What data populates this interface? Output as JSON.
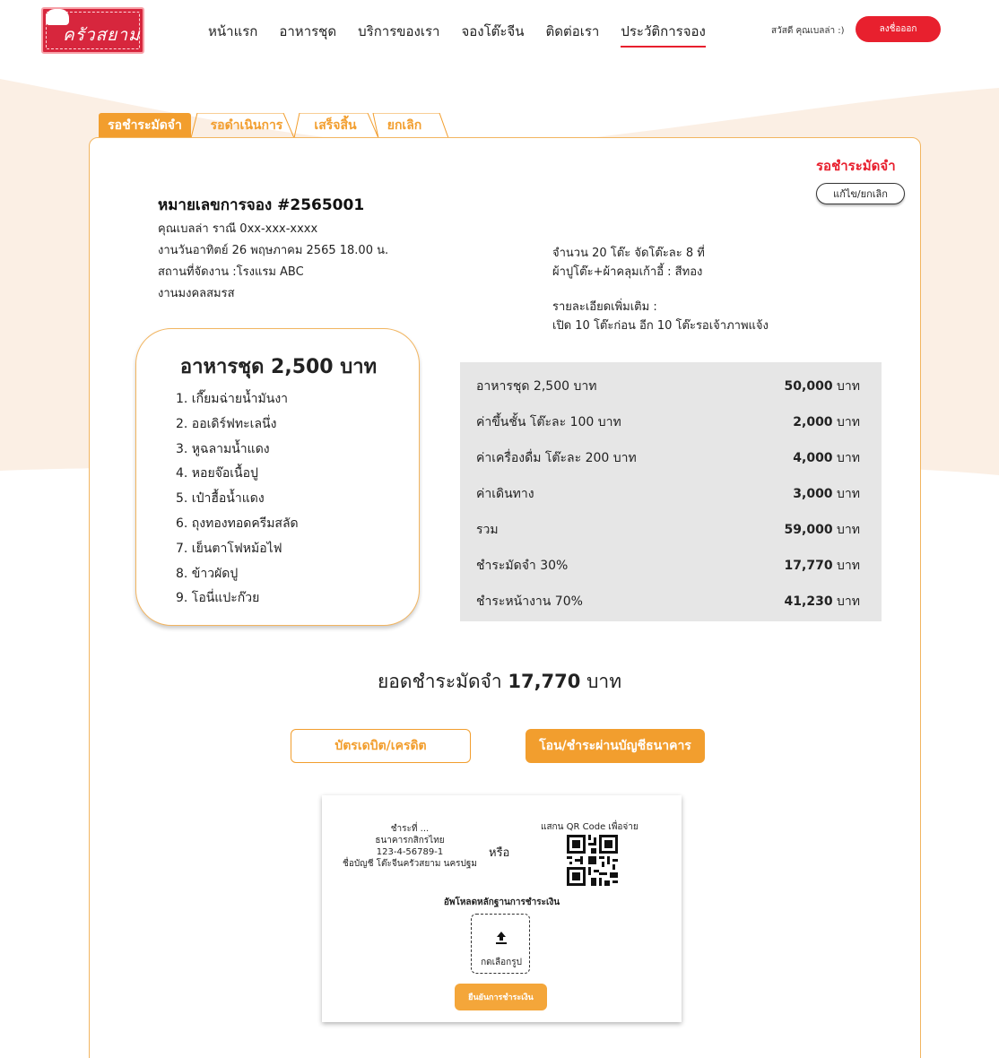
{
  "logo": {
    "text": "ครัวสยาม"
  },
  "nav": {
    "items": [
      {
        "label": "หน้าแรก"
      },
      {
        "label": "อาหารชุด"
      },
      {
        "label": "บริการของเรา"
      },
      {
        "label": "จองโต๊ะจีน"
      },
      {
        "label": "ติดต่อเรา"
      },
      {
        "label": "ประวัติการจอง"
      }
    ],
    "active": "ประวัติการจอง"
  },
  "user": {
    "greeting": "สวัสดี คุณเบลล่า :)",
    "logout_label": "ลงชื่อออก"
  },
  "tabs": [
    {
      "label": "รอชำระมัดจำ"
    },
    {
      "label": "รอดำเนินการ"
    },
    {
      "label": "เสร็จสิ้น"
    },
    {
      "label": "ยกเลิก"
    }
  ],
  "booking": {
    "status": "รอชำระมัดจำ",
    "edit_label": "แก้ไข/ยกเลิก",
    "number": "หมายเลขการจอง #2565001",
    "customer": "คุณเบลล่า ราณี 0xx-xxx-xxxx",
    "date": "งานวันอาทิตย์ 26 พฤษภาคม 2565 18.00 น.",
    "venue": "สถานที่จัดงาน :โรงแรม ABC",
    "event": "งานมงคลสมรส",
    "tables": "จำนวน 20 โต๊ะ จัดโต๊ะละ 8 ที่",
    "cloth": "ผ้าปูโต๊ะ+ผ้าคลุมเก้าอี้ : สีทอง",
    "details_label": "รายละเอียดเพิ่มเติม :",
    "details": "เปิด 10 โต๊ะก่อน อีก 10 โต๊ะรอเจ้าภาพแจ้ง"
  },
  "menu": {
    "title": "อาหารชุด 2,500 บาท",
    "items": [
      "1. เกี๊ยมฉ่ายน้ำมันงา",
      "2. ออเดิร์ฟทะเลนึ่ง",
      "3. หูฉลามน้ำแดง",
      "4. หอยจ๊อเนื้อปู",
      "5. เป๋าฮื้อน้ำแดง",
      "6. ถุงทองทอดครีมสลัด",
      "7. เย็นตาโฟหม้อไฟ",
      "8. ข้าวผัดปู",
      "9. โอนี่แปะก๊วย"
    ]
  },
  "prices": [
    {
      "label": "อาหารชุด 2,500 บาท",
      "amount": "50,000",
      "unit": " บาท"
    },
    {
      "label": "ค่าขึ้นชั้น โต๊ะละ 100 บาท",
      "amount": "2,000",
      "unit": " บาท"
    },
    {
      "label": "ค่าเครื่องดื่ม โต๊ะละ 200 บาท",
      "amount": "4,000",
      "unit": " บาท"
    },
    {
      "label": "ค่าเดินทาง",
      "amount": "3,000",
      "unit": " บาท"
    },
    {
      "label": "รวม",
      "amount": "59,000",
      "unit": " บาท"
    },
    {
      "label": "ชำระมัดจำ 30%",
      "amount": "17,770",
      "unit": " บาท"
    },
    {
      "label": "ชำระหน้างาน 70%",
      "amount": "41,230",
      "unit": " บาท"
    }
  ],
  "payment": {
    "total_label": "ยอดชำระมัดจำ ",
    "total_amount": "17,770",
    "total_unit": " บาท",
    "card_label": "บัตรเดบิต/เครดิต",
    "bank_label": "โอน/ชำระผ่านบัญชีธนาคาร",
    "pay_to": "ชำระที่ ...",
    "bank_name": "ธนาคารกสิกรไทย",
    "account_no": "123-4-56789-1",
    "account_name": "ชื่อบัญชี โต๊ะจีนครัวสยาม นครปฐม",
    "or": "หรือ",
    "qr_label": "แสกน QR Code เพื่อจ่าย",
    "upload_label": "อัพโหลดหลักฐานการชำระเงิน",
    "upload_button": "กดเลือกรูป",
    "confirm_label": "ยืนยันการชำระเงิน"
  },
  "colors": {
    "primary": "#f29e2e",
    "accent": "#e8202e",
    "table_bg": "#e6e6e6"
  }
}
